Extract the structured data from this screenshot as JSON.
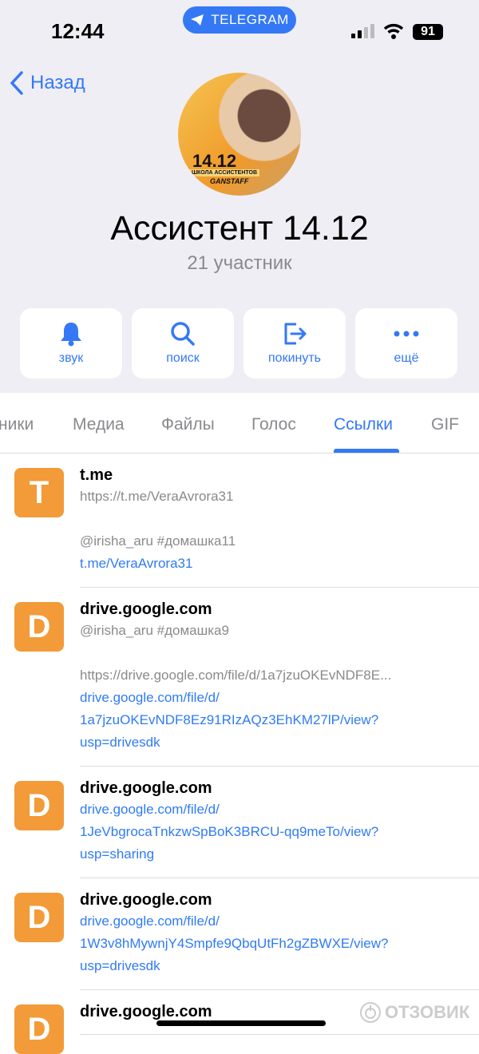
{
  "status": {
    "time": "12:44",
    "app_pill": "TELEGRAM",
    "battery": "91"
  },
  "nav": {
    "back": "Назад"
  },
  "avatar": {
    "number": "14.12",
    "subtitle": "ШКОЛА АССИСТЕНТОВ",
    "brand": "GANSTAFF"
  },
  "chat": {
    "title": "Ассистент 14.12",
    "members": "21 участник"
  },
  "actions": [
    {
      "label": "звук",
      "icon": "bell-icon"
    },
    {
      "label": "поиск",
      "icon": "search-icon"
    },
    {
      "label": "покинуть",
      "icon": "leave-icon"
    },
    {
      "label": "ещё",
      "icon": "more-icon"
    }
  ],
  "tabs": [
    {
      "label": "ники"
    },
    {
      "label": "Медиа"
    },
    {
      "label": "Файлы"
    },
    {
      "label": "Голос"
    },
    {
      "label": "Ссылки",
      "active": true
    },
    {
      "label": "GIF"
    }
  ],
  "links": [
    {
      "letter": "T",
      "domain": "t.me",
      "lines": [
        {
          "t": "https://t.me/VeraAvrora31",
          "k": "line"
        },
        {
          "t": "",
          "k": "gap"
        },
        {
          "t": "@irisha_aru #домашка11",
          "k": "line"
        },
        {
          "t": "t.me/VeraAvrora31",
          "k": "link"
        }
      ]
    },
    {
      "letter": "D",
      "domain": "drive.google.com",
      "lines": [
        {
          "t": "@irisha_aru #домашка9",
          "k": "line"
        },
        {
          "t": "",
          "k": "gap"
        },
        {
          "t": "https://drive.google.com/file/d/1a7jzuOKEvNDF8E...",
          "k": "line"
        },
        {
          "t": "drive.google.com/file/d/",
          "k": "link"
        },
        {
          "t": "1a7jzuOKEvNDF8Ez91RIzAQz3EhKM27lP/view?",
          "k": "link"
        },
        {
          "t": "usp=drivesdk",
          "k": "link"
        }
      ]
    },
    {
      "letter": "D",
      "domain": "drive.google.com",
      "lines": [
        {
          "t": "drive.google.com/file/d/",
          "k": "link"
        },
        {
          "t": "1JeVbgrocaTnkzwSpBoK3BRCU-qq9meTo/view?",
          "k": "link"
        },
        {
          "t": "usp=sharing",
          "k": "link"
        }
      ]
    },
    {
      "letter": "D",
      "domain": "drive.google.com",
      "lines": [
        {
          "t": "drive.google.com/file/d/",
          "k": "link"
        },
        {
          "t": "1W3v8hMywnjY4Smpfe9QbqUtFh2gZBWXE/view?",
          "k": "link"
        },
        {
          "t": "usp=drivesdk",
          "k": "link"
        }
      ]
    },
    {
      "letter": "D",
      "domain": "drive.google.com",
      "lines": []
    }
  ],
  "watermark": "ОТЗОВИК",
  "colors": {
    "accent": "#3478f6",
    "icon_bg": "#f29b38",
    "bg": "#efeef4"
  }
}
